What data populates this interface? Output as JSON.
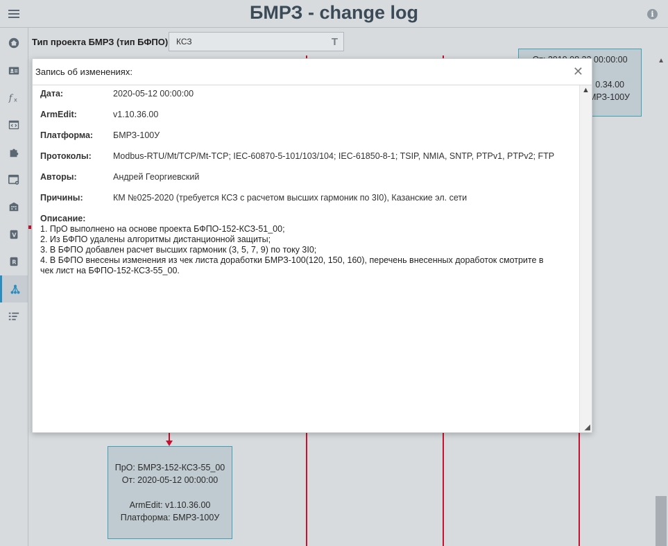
{
  "header": {
    "title": "БМРЗ - change log"
  },
  "filter": {
    "label": "Тип проекта БМРЗ (тип БФПО):",
    "value": "КСЗ",
    "filter_icon": "filter-icon"
  },
  "sidebar": {
    "items": [
      {
        "name": "home-icon"
      },
      {
        "name": "id-card-icon"
      },
      {
        "name": "function-icon"
      },
      {
        "name": "code-window-icon"
      },
      {
        "name": "puzzle-icon"
      },
      {
        "name": "settings-window-icon"
      },
      {
        "name": "building-icon"
      },
      {
        "name": "v-badge-icon"
      },
      {
        "name": "r-badge-icon"
      },
      {
        "name": "hierarchy-icon",
        "active": true
      },
      {
        "name": "list-settings-icon"
      }
    ]
  },
  "graph": {
    "top_node": {
      "line1": "От: 2019.08.22 00:00:00",
      "line2": "0.34.00",
      "line3": "БМРЗ-100У"
    },
    "bottom_node": {
      "line1": "ПрО: БМРЗ-152-КСЗ-55_00",
      "line2": "От: 2020-05-12 00:00:00",
      "line3": "ArmEdit: v1.10.36.00",
      "line4": "Платформа: БМРЗ-100У"
    }
  },
  "modal": {
    "title": "Запись об изменениях:",
    "fields": [
      {
        "label": "Дата:",
        "value": "2020-05-12 00:00:00"
      },
      {
        "label": "ArmEdit:",
        "value": "v1.10.36.00"
      },
      {
        "label": "Платформа:",
        "value": "БМРЗ-100У"
      },
      {
        "label": "Протоколы:",
        "value": "Modbus-RTU/Mt/TCP/Mt-TCP; IEC-60870-5-101/103/104; IEC-61850-8-1; TSIP, NMIA, SNTP, PTPv1, PTPv2; FTP"
      },
      {
        "label": "Авторы:",
        "value": "Андрей Георгиевский"
      },
      {
        "label": "Причины:",
        "value": "КМ №025-2020 (требуется КСЗ с расчетом высших гармоник по 3I0), Казанские эл. сети"
      }
    ],
    "description_label": "Описание:",
    "description_lines": [
      "1. ПрО выполнено на основе проекта БФПО-152-КСЗ-51_00;",
      "2. Из БФПО удалены алгоритмы дистанционной защиты;",
      "3. В БФПО добавлен расчет высших гармоник (3, 5, 7, 9) по току 3I0;",
      "4. В БФПО внесены изменения из чек листа доработки БМРЗ-100(120, 150, 160), перечень внесенных доработок смотрите в",
      "чек лист на БФПО-152-КСЗ-55_00."
    ]
  },
  "colors": {
    "accent": "#2a8dbd",
    "line_red": "#c8102e",
    "node_border": "#3ea0b5",
    "background": "#d7dbde"
  }
}
